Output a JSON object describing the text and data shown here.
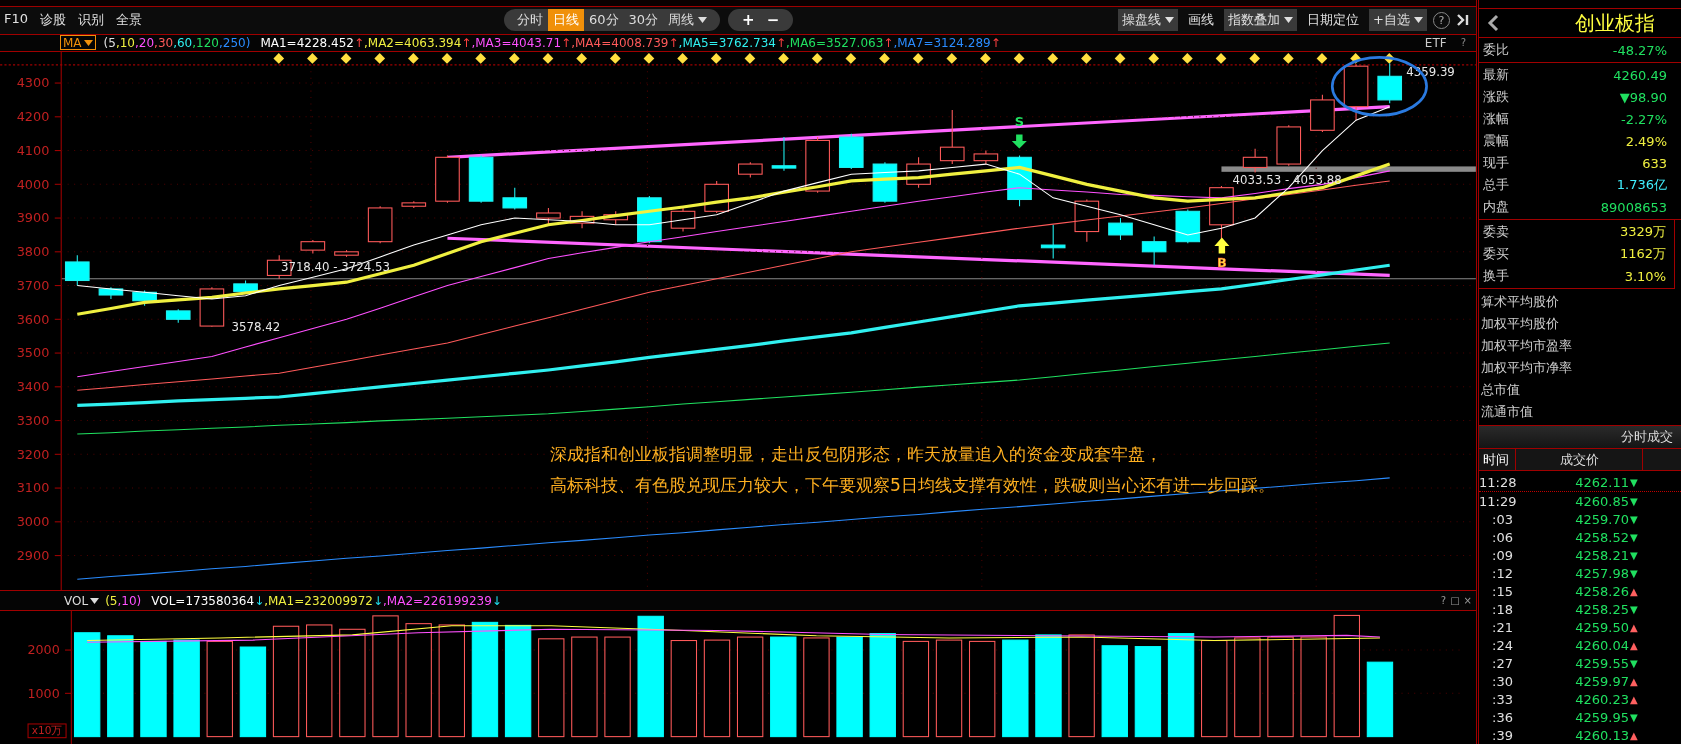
{
  "toolbar": {
    "menu": [
      "F10",
      "诊股",
      "识别",
      "全景"
    ],
    "periods": [
      {
        "label": "分时",
        "selected": false,
        "dropdown": false
      },
      {
        "label": "日线",
        "selected": true,
        "dropdown": false
      },
      {
        "label": "60分",
        "selected": false,
        "dropdown": false
      },
      {
        "label": "30分",
        "selected": false,
        "dropdown": false
      },
      {
        "label": "周线",
        "selected": false,
        "dropdown": true
      }
    ],
    "zoom": [
      "+",
      "−"
    ],
    "tools": [
      {
        "label": "操盘线",
        "kind": "dropdown"
      },
      {
        "label": "画线",
        "kind": "plain"
      },
      {
        "label": "指数叠加",
        "kind": "dropdown"
      },
      {
        "label": "日期定位",
        "kind": "plain"
      },
      {
        "label": "+自选",
        "kind": "dropdown"
      }
    ],
    "help": "?"
  },
  "ma_legend": {
    "button": "MA",
    "params": [
      {
        "text": "(5"
      },
      {
        "text": ",10"
      },
      {
        "text": ",20"
      },
      {
        "text": ",30"
      },
      {
        "text": ",60"
      },
      {
        "text": ",120"
      },
      {
        "text": ",250)"
      }
    ],
    "values": [
      {
        "text": "=4228.452",
        "arrow": "↑"
      },
      {
        "lead": ",",
        "text": "=4063.394",
        "arrow": "↑"
      },
      {
        "lead": ",",
        "text": "=4043.71",
        "arrow": "↑"
      },
      {
        "lead": ",",
        "text": "=4008.739",
        "arrow": "↑"
      },
      {
        "lead": ",",
        "text": "=3762.734",
        "arrow": "↑"
      },
      {
        "lead": ",",
        "text": "=3527.063",
        "arrow": "↑"
      },
      {
        "lead": ",",
        "text": "=3124.289",
        "arrow": "↑"
      }
    ],
    "etf": "ETF",
    "help": "?"
  },
  "chart": {
    "chart_data": {
      "type": "line",
      "grid": true,
      "ylim": [
        2798,
        4392
      ],
      "yticks": [
        4300,
        4200,
        4100,
        4000,
        3900,
        3800,
        3700,
        3600,
        3500,
        3400,
        3300,
        3200,
        3100,
        3000,
        2900
      ],
      "series": [
        {
          "name": "MA1",
          "color": "#ffffff",
          "values": [
            3700,
            3690,
            3680,
            3670,
            3660,
            3670,
            3700,
            3725,
            3750,
            3785,
            3820,
            3850,
            3880,
            3900,
            3895,
            3890,
            3880,
            3880,
            3895,
            3910,
            3945,
            3980,
            4005,
            4030,
            4035,
            4040,
            4050,
            4060,
            4030,
            3960,
            3935,
            3910,
            3880,
            3850,
            3870,
            3900,
            3990,
            4100,
            4190,
            4230
          ]
        },
        {
          "name": "MA2",
          "color": "#f0f040",
          "values": [
            3615,
            3632,
            3650,
            3658,
            3665,
            3678,
            3690,
            3700,
            3710,
            3735,
            3760,
            3795,
            3830,
            3855,
            3880,
            3893,
            3907,
            3920,
            3933,
            3947,
            3960,
            3977,
            3993,
            4010,
            4015,
            4020,
            4030,
            4040,
            4050,
            4025,
            4000,
            3980,
            3960,
            3950,
            3955,
            3960,
            3975,
            3990,
            4025,
            4060
          ]
        },
        {
          "name": "MA3",
          "color": "#ff50ff",
          "values": [
            3430,
            3445,
            3460,
            3475,
            3490,
            3518,
            3545,
            3573,
            3600,
            3633,
            3667,
            3700,
            3727,
            3753,
            3780,
            3797,
            3813,
            3830,
            3845,
            3860,
            3875,
            3890,
            3905,
            3920,
            3935,
            3950,
            3963,
            3977,
            3990,
            3983,
            3977,
            3970,
            3967,
            3963,
            3960,
            3973,
            3987,
            4000,
            4020,
            4040
          ]
        },
        {
          "name": "MA4",
          "color": "#ff5a5a",
          "values": [
            3390,
            3398,
            3407,
            3415,
            3423,
            3432,
            3440,
            3458,
            3476,
            3494,
            3512,
            3530,
            3555,
            3580,
            3605,
            3630,
            3655,
            3680,
            3700,
            3720,
            3740,
            3760,
            3780,
            3800,
            3814,
            3828,
            3842,
            3856,
            3870,
            3882,
            3894,
            3906,
            3918,
            3930,
            3943,
            3957,
            3970,
            3983,
            3997,
            4010
          ]
        },
        {
          "name": "MA5",
          "color": "#30f0f0",
          "values": [
            3345,
            3349,
            3353,
            3358,
            3362,
            3366,
            3370,
            3380,
            3390,
            3400,
            3410,
            3420,
            3430,
            3440,
            3450,
            3462,
            3474,
            3487,
            3499,
            3511,
            3523,
            3536,
            3548,
            3560,
            3576,
            3592,
            3608,
            3624,
            3640,
            3648,
            3657,
            3665,
            3673,
            3682,
            3690,
            3704,
            3718,
            3732,
            3746,
            3760
          ]
        },
        {
          "name": "MA6",
          "color": "#20e060",
          "values": [
            3260,
            3264,
            3269,
            3273,
            3277,
            3281,
            3286,
            3290,
            3294,
            3299,
            3303,
            3307,
            3311,
            3316,
            3320,
            3327,
            3334,
            3341,
            3349,
            3356,
            3363,
            3370,
            3377,
            3384,
            3391,
            3399,
            3406,
            3413,
            3420,
            3430,
            3440,
            3450,
            3460,
            3470,
            3480,
            3490,
            3500,
            3510,
            3520,
            3530
          ]
        },
        {
          "name": "MA7",
          "color": "#2a8cff",
          "values": [
            2830,
            2838,
            2845,
            2853,
            2861,
            2868,
            2876,
            2884,
            2892,
            2899,
            2907,
            2915,
            2922,
            2930,
            2938,
            2945,
            2953,
            2961,
            2968,
            2976,
            2984,
            2992,
            2999,
            3007,
            3015,
            3022,
            3030,
            3038,
            3045,
            3053,
            3061,
            3068,
            3076,
            3084,
            3092,
            3099,
            3107,
            3115,
            3122,
            3130
          ]
        }
      ]
    },
    "price_labels": [
      "3718.40 - 3724.53",
      "3578.42",
      "4033.53 - 4053.88",
      "4359.39"
    ],
    "signals": [
      {
        "label": "S",
        "kind": "sell"
      },
      {
        "label": "B",
        "kind": "buy"
      }
    ],
    "comment": [
      "深成指和创业板指调整明显，走出反包阴形态，昨天放量追入的资金变成套牢盘，",
      "高标科技、有色股兑现压力较大，下午要观察5日均线支撑有效性，跌破则当心还有进一步回踩。"
    ]
  },
  "volume": {
    "button": "VOL",
    "params": [
      {
        "text": "(5"
      },
      {
        "text": ",10)"
      }
    ],
    "values": [
      {
        "text": "VOL=173580364",
        "arrow": "↓"
      },
      {
        "text": ",MA1=232009972",
        "arrow": "↓"
      },
      {
        "text": ",MA2=226199239",
        "arrow": "↓"
      }
    ],
    "tools": [
      "?",
      "□",
      "×"
    ],
    "y_labels": [
      "2000",
      "1000"
    ],
    "unit": "x10万"
  },
  "quote": {
    "title": "创业板指",
    "groups": [
      [
        {
          "label": "委比",
          "value": "-48.27%",
          "color": "#20e060"
        }
      ],
      [
        {
          "label": "最新",
          "value": "4260.49",
          "color": "#20e060"
        },
        {
          "label": "涨跌",
          "value": "▼98.90",
          "color": "#20e060"
        },
        {
          "label": "涨幅",
          "value": "-2.27%",
          "color": "#20e060"
        },
        {
          "label": "震幅",
          "value": "2.49%",
          "color": "#f0f040"
        },
        {
          "label": "现手",
          "value": "633",
          "color": "#f0f040"
        },
        {
          "label": "总手",
          "value": "1.736亿",
          "color": "#40f0ff"
        },
        {
          "label": "内盘",
          "value": "89008653",
          "color": "#20e060"
        }
      ],
      [
        {
          "label": "委卖",
          "value": "3329万",
          "color": "#f0f040"
        },
        {
          "label": "委买",
          "value": "1162万",
          "color": "#f0f040"
        },
        {
          "label": "换手",
          "value": "3.10%",
          "color": "#f0f040"
        }
      ]
    ],
    "stats": [
      "算术平均股价",
      "加权平均股价",
      "加权平均市盈率",
      "加权平均市净率",
      "总市值",
      "流通市值"
    ]
  },
  "trades": {
    "title": "分时成交",
    "columns": [
      "时间",
      "成交价"
    ],
    "rows": [
      {
        "time": "11:28",
        "price": "4262.11",
        "arrow": "▼",
        "kind": "down"
      },
      {
        "time": "11:29",
        "price": "4260.85",
        "arrow": "▼",
        "kind": "down"
      },
      {
        "time": ":03",
        "price": "4259.70",
        "arrow": "▼",
        "kind": "down"
      },
      {
        "time": ":06",
        "price": "4258.52",
        "arrow": "▼",
        "kind": "down"
      },
      {
        "time": ":09",
        "price": "4258.21",
        "arrow": "▼",
        "kind": "down"
      },
      {
        "time": ":12",
        "price": "4257.98",
        "arrow": "▼",
        "kind": "down"
      },
      {
        "time": ":15",
        "price": "4258.26",
        "arrow": "▲",
        "kind": "up"
      },
      {
        "time": ":18",
        "price": "4258.25",
        "arrow": "▼",
        "kind": "down"
      },
      {
        "time": ":21",
        "price": "4259.50",
        "arrow": "▲",
        "kind": "up"
      },
      {
        "time": ":24",
        "price": "4260.04",
        "arrow": "▲",
        "kind": "up"
      },
      {
        "time": ":27",
        "price": "4259.55",
        "arrow": "▼",
        "kind": "down"
      },
      {
        "time": ":30",
        "price": "4259.97",
        "arrow": "▲",
        "kind": "up"
      },
      {
        "time": ":33",
        "price": "4260.23",
        "arrow": "▲",
        "kind": "up"
      },
      {
        "time": ":36",
        "price": "4259.95",
        "arrow": "▼",
        "kind": "down"
      },
      {
        "time": ":39",
        "price": "4260.13",
        "arrow": "▲",
        "kind": "up"
      }
    ]
  }
}
